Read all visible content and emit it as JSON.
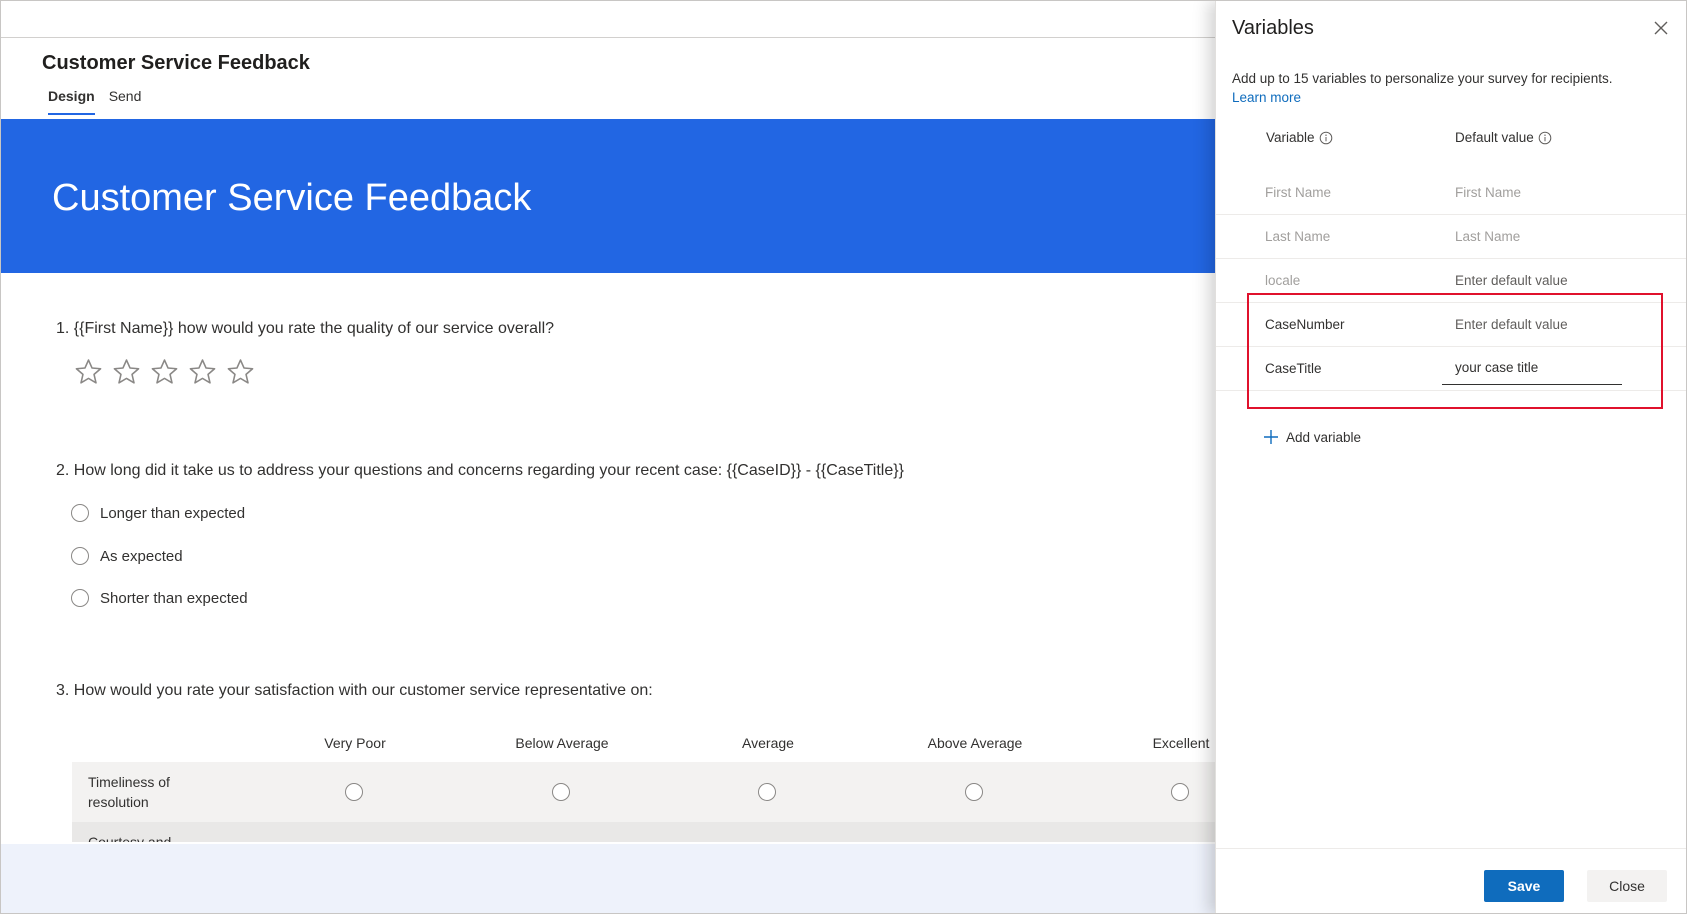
{
  "app": {
    "survey_name": "Customer Service Feedback",
    "tabs": [
      {
        "label": "Design",
        "active": true
      },
      {
        "label": "Send",
        "active": false
      }
    ],
    "banner_title": "Customer Service Feedback",
    "accent_color": "#2266e3"
  },
  "questions": {
    "q1": {
      "text": "1. {{First Name}} how would you rate the quality of our service overall?",
      "rating_stars": 5,
      "rating_value": 0
    },
    "q2": {
      "text": "2. How long did it take us to address your questions and concerns regarding your recent case: {{CaseID}} - {{CaseTitle}}",
      "options": [
        "Longer than expected",
        "As expected",
        "Shorter than expected"
      ]
    },
    "q3": {
      "text": "3. How would you rate your satisfaction with our customer service representative on:",
      "columns": [
        "Very Poor",
        "Below Average",
        "Average",
        "Above Average",
        "Excellent"
      ],
      "rows": [
        "Timeliness of resolution",
        "Courtesy and"
      ]
    }
  },
  "panel": {
    "title": "Variables",
    "description": "Add up to 15 variables to personalize your survey for recipients.",
    "learn_more": "Learn more",
    "col_variable": "Variable",
    "col_default": "Default value",
    "variables": [
      {
        "name": "First Name",
        "default": "First Name"
      },
      {
        "name": "Last Name",
        "default": "Last Name"
      },
      {
        "name": "locale",
        "default": "Enter default value"
      },
      {
        "name": "CaseNumber",
        "default_placeholder": "Enter default value"
      },
      {
        "name": "CaseTitle",
        "default_value": "your case title"
      }
    ],
    "add_variable": "Add variable",
    "save_label": "Save",
    "close_label": "Close",
    "highlight_color": "#e0112c",
    "save_color": "#0f6cbd"
  }
}
